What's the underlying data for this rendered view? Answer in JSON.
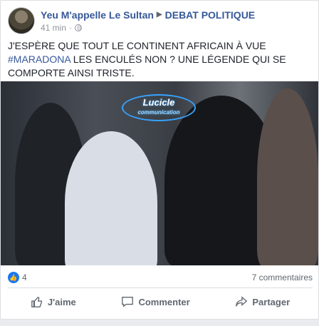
{
  "post": {
    "author": "Yeu M'appelle Le Sultan",
    "group": "DEBAT POLITIQUE",
    "time": "41 min",
    "separator": "·",
    "text_before": "J'ESPÈRE QUE TOUT LE CONTINENT AFRICAIN À VUE ",
    "hashtag": "#MARADONA",
    "text_after": " LES ENCULÉS NON ? UNE LÉGENDE QUI SE COMPORTE AINSI TRISTE.",
    "image_watermark_line1": "Lucicle",
    "image_watermark_line2": "communication"
  },
  "stats": {
    "reactions": "4",
    "comments": "7 commentaires"
  },
  "actions": {
    "like": "J'aime",
    "comment": "Commenter",
    "share": "Partager"
  },
  "icons": [
    "globe-icon",
    "like-reaction-icon",
    "thumbs-up-icon",
    "comment-icon",
    "share-icon"
  ],
  "colors": {
    "link": "#365899",
    "text": "#1d2129",
    "muted": "#606770",
    "like": "#1877f2"
  }
}
